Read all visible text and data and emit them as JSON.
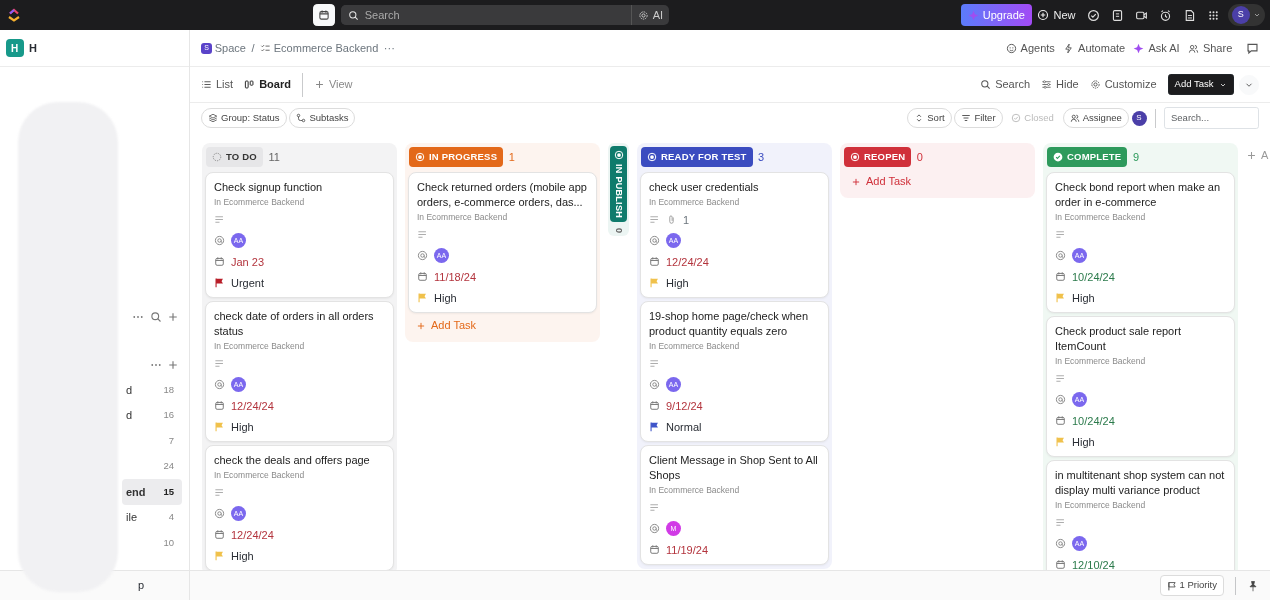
{
  "topbar": {
    "search": {
      "placeholder": "Search"
    },
    "ai_button": "AI",
    "upgrade": "Upgrade",
    "new_button": "New",
    "avatar": "S"
  },
  "sidebar": {
    "workspace_badge": "H",
    "workspace_name": "H",
    "items": [
      {
        "label": "d",
        "count": "18",
        "selected": false
      },
      {
        "label": "d",
        "count": "16",
        "selected": false
      },
      {
        "count": "7",
        "selected": false
      },
      {
        "count": "24",
        "selected": false
      },
      {
        "label": "end",
        "count": "15",
        "selected": true
      },
      {
        "label": "ile",
        "count": "4",
        "selected": false
      },
      {
        "count": "10",
        "selected": false
      }
    ],
    "footer": "p"
  },
  "header": {
    "space_badge": "S",
    "space": "Space",
    "separator": "/",
    "list_name": "Ecommerce Backend",
    "more": "···",
    "actions": [
      "Agents",
      "Automate",
      "Ask AI",
      "Share"
    ]
  },
  "views": {
    "tabs": [
      {
        "label": "List",
        "selected": false
      },
      {
        "label": "Board",
        "selected": true
      }
    ],
    "add_view": "View",
    "search": "Search",
    "hide": "Hide",
    "customize": "Customize",
    "add_task": "Add Task"
  },
  "filters": {
    "group": "Group: Status",
    "subtasks": "Subtasks",
    "sort": "Sort",
    "filter": "Filter",
    "closed": {
      "label": "Closed",
      "disabled": true
    },
    "assignee": "Assignee",
    "assignee_avatar": "S",
    "search": {
      "placeholder": "Search..."
    }
  },
  "columns": [
    {
      "status": "TO DO",
      "count": "11",
      "kind": "open",
      "color": "#e8e8ea",
      "collapsed": false,
      "cards": [
        {
          "title": "Check signup function",
          "location": "In Ecommerce Backend",
          "assignee": {
            "initials": "AA",
            "color": "#7b68ee"
          },
          "due": "Jan 23",
          "overdue": true,
          "priority": {
            "label": "Urgent",
            "color": "#b81d28"
          }
        },
        {
          "title": "check date of orders in all orders status",
          "location": "In Ecommerce Backend",
          "assignee": {
            "initials": "AA",
            "color": "#7b68ee"
          },
          "due": "12/24/24",
          "overdue": true,
          "priority": {
            "label": "High",
            "color": "#f0c14b"
          }
        },
        {
          "title": "check the deals and offers page",
          "location": "In Ecommerce Backend",
          "assignee": {
            "initials": "AA",
            "color": "#7b68ee"
          },
          "due": "12/24/24",
          "overdue": true,
          "priority": {
            "label": "High",
            "color": "#f0c14b"
          }
        }
      ]
    },
    {
      "status": "IN PROGRESS",
      "count": "1",
      "kind": "active",
      "color": "#e3691a",
      "collapsed": false,
      "add_task": "Add Task",
      "cards": [
        {
          "title": "Check returned orders (mobile app orders, e-commerce orders, das...",
          "location": "In Ecommerce Backend",
          "assignee": {
            "initials": "AA",
            "color": "#7b68ee"
          },
          "due": "11/18/24",
          "overdue": true,
          "priority": {
            "label": "High",
            "color": "#f0c14b"
          }
        }
      ]
    },
    {
      "status": "IN PUBLISH",
      "count": "0",
      "kind": "active",
      "color": "#0f7b6c",
      "collapsed": true
    },
    {
      "status": "READY FOR TEST",
      "count": "3",
      "kind": "active",
      "color": "#3b4cc0",
      "collapsed": false,
      "cards": [
        {
          "title": "check user credentials",
          "location": "In Ecommerce Backend",
          "attachments": "1",
          "assignee": {
            "initials": "AA",
            "color": "#7b68ee"
          },
          "due": "12/24/24",
          "overdue": true,
          "priority": {
            "label": "High",
            "color": "#f0c14b"
          }
        },
        {
          "title": "19-shop home page/check when product quantity equals zero",
          "location": "In Ecommerce Backend",
          "assignee": {
            "initials": "AA",
            "color": "#7b68ee"
          },
          "due": "9/12/24",
          "overdue": true,
          "priority": {
            "label": "Normal",
            "color": "#3f55c9"
          }
        },
        {
          "title": "Client Message in Shop Sent to All Shops",
          "location": "In Ecommerce Backend",
          "assignee": {
            "initials": "M",
            "color": "#d13be6"
          },
          "due": "11/19/24",
          "overdue": true
        }
      ]
    },
    {
      "status": "REOPEN",
      "count": "0",
      "kind": "active",
      "color": "#d0303a",
      "collapsed": false,
      "add_task": "Add Task"
    },
    {
      "status": "COMPLETE",
      "count": "9",
      "kind": "closed",
      "color": "#2e9a5c",
      "collapsed": false,
      "cards": [
        {
          "title": "Check bond report when make an order in e-commerce",
          "location": "In Ecommerce Backend",
          "assignee": {
            "initials": "AA",
            "color": "#7b68ee"
          },
          "due": "10/24/24",
          "overdue": false,
          "priority": {
            "label": "High",
            "color": "#f0c14b"
          }
        },
        {
          "title": "Check product sale report ItemCount",
          "location": "In Ecommerce Backend",
          "assignee": {
            "initials": "AA",
            "color": "#7b68ee"
          },
          "due": "10/24/24",
          "overdue": false,
          "priority": {
            "label": "High",
            "color": "#f0c14b"
          }
        },
        {
          "title": "in multitenant shop system can not display multi variance product",
          "location": "In Ecommerce Backend",
          "assignee": {
            "initials": "AA",
            "color": "#7b68ee"
          },
          "due": "12/10/24",
          "overdue": false
        }
      ]
    }
  ],
  "add_group": "A",
  "bottom_bar": {
    "priority_button": "1 Priority"
  }
}
